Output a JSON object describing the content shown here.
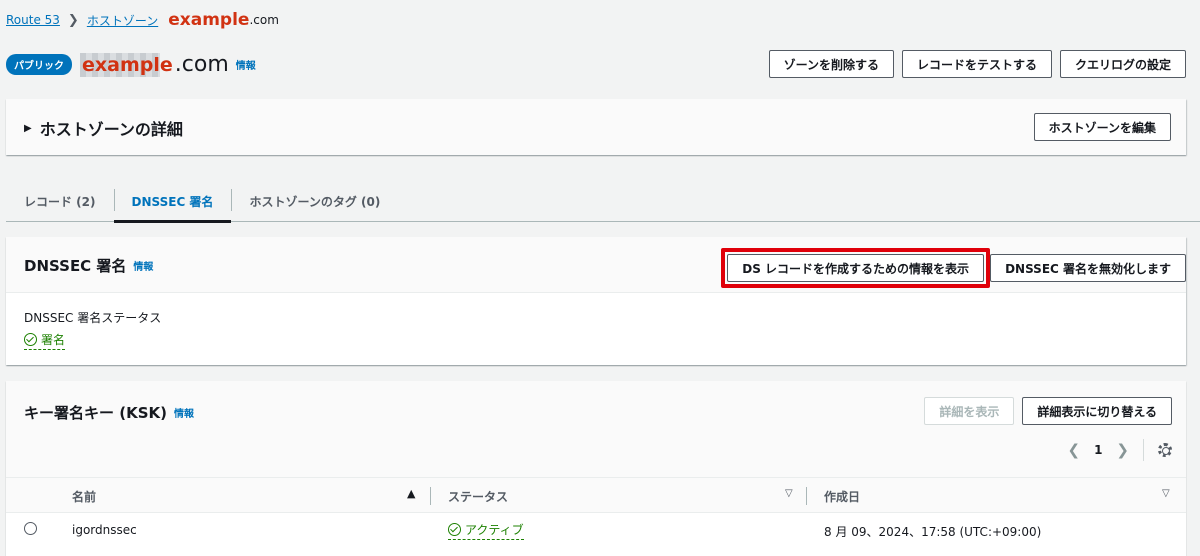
{
  "breadcrumb": {
    "route53": "Route 53",
    "hosted_zones": "ホストゾーン",
    "redacted_domain": "example",
    "domain_suffix": ".com"
  },
  "header": {
    "badge": "パブリック",
    "redacted_label": "example",
    "domain_suffix": ".com",
    "info": "情報",
    "buttons": {
      "delete_zone": "ゾーンを削除する",
      "test_record": "レコードをテストする",
      "query_logging": "クエリログの設定"
    }
  },
  "details_panel": {
    "heading": "ホストゾーンの詳細",
    "edit_button": "ホストゾーンを編集"
  },
  "tabs": [
    {
      "label": "レコード (2)",
      "active": false
    },
    {
      "label": "DNSSEC 署名",
      "active": true
    },
    {
      "label": "ホストゾーンのタグ (0)",
      "active": false
    }
  ],
  "dnssec": {
    "title": "DNSSEC 署名",
    "info": "情報",
    "show_ds_button": "DS レコードを作成するための情報を表示",
    "disable_button": "DNSSEC 署名を無効化します",
    "status_label": "DNSSEC 署名ステータス",
    "status_value": "署名"
  },
  "ksk": {
    "title": "キー署名キー (KSK)",
    "info": "情報",
    "view_details_button": "詳細を表示",
    "toggle_details_button": "詳細表示に切り替える",
    "page": "1",
    "columns": {
      "name": "名前",
      "status": "ステータス",
      "created": "作成日"
    },
    "rows": [
      {
        "name": "igordnssec",
        "status": "アクティブ",
        "created": "8 月 09、2024、17:58 (UTC:+09:00)"
      }
    ]
  },
  "colors": {
    "link": "#0073bb",
    "success": "#1d8102",
    "highlight": "#e0000a",
    "redaction": "#d13212"
  }
}
